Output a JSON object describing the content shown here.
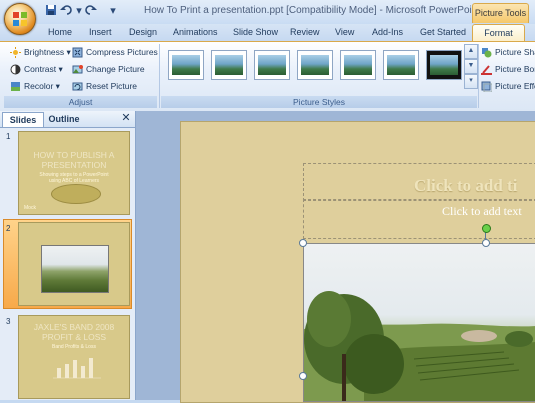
{
  "window": {
    "title": "How To Print a presentation.ppt [Compatibility Mode] - Microsoft PowerPoint",
    "contextual_tab": "Picture Tools"
  },
  "quick_access": [
    "save-icon",
    "undo-icon",
    "redo-icon",
    "customize-icon"
  ],
  "tabs": [
    "Home",
    "Insert",
    "Design",
    "Animations",
    "Slide Show",
    "Review",
    "View",
    "Add-Ins",
    "Get Started",
    "Format"
  ],
  "ribbon": {
    "adjust": {
      "label": "Adjust",
      "brightness": "Brightness",
      "contrast": "Contrast",
      "recolor": "Recolor",
      "compress": "Compress Pictures",
      "change": "Change Picture",
      "reset": "Reset Picture"
    },
    "styles": {
      "label": "Picture Styles",
      "shape": "Picture Sha",
      "border": "Picture Bor",
      "effects": "Picture Effe"
    }
  },
  "pane": {
    "tab_slides": "Slides",
    "tab_outline": "Outline",
    "close": "✕",
    "slides": [
      {
        "num": "1",
        "title": "HOW TO PUBLISH A PRESENTATION",
        "subtitle": "Showing steps to a PowerPoint using ABC of Learners",
        "footer": "Mock"
      },
      {
        "num": "2"
      },
      {
        "num": "3",
        "title": "JAXLE'S BAND 2008 PROFIT & LOSS",
        "subtitle": "Band Profits & Loss"
      }
    ]
  },
  "slide": {
    "title_placeholder": "Click to add ti",
    "subtitle_placeholder": "Click to add text"
  },
  "colors": {
    "accent": "#f5c86b",
    "slide_bg": "#dfcf9c"
  }
}
